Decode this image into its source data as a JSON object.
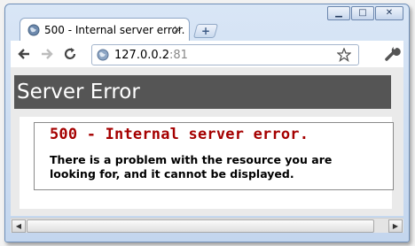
{
  "tab": {
    "title": "500 - Internal server error.",
    "close": "×"
  },
  "new_tab": {
    "label": "+"
  },
  "window": {
    "minimize": "▁",
    "maximize": "□",
    "close": "✕"
  },
  "address": {
    "host": "127.0.0.2",
    "port": ":81"
  },
  "page": {
    "banner": "Server Error",
    "error_title": "500 - Internal server error.",
    "error_message": "There is a problem with the resource you are looking for, and it cannot be displayed."
  },
  "scrollbar": {
    "left": "◀",
    "right": "▶"
  },
  "colors": {
    "banner_bg": "#555555",
    "error_red": "#a50000"
  }
}
